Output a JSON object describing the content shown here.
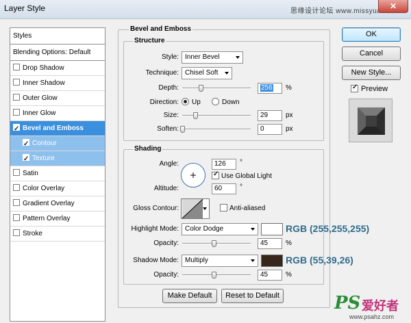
{
  "window": {
    "title": "Layer Style",
    "watermark_top": "思缘设计论坛 www.missyuan.com",
    "close_glyph": "✕"
  },
  "styles_panel": {
    "header": "Styles",
    "blending": "Blending Options: Default",
    "items": [
      {
        "label": "Drop Shadow",
        "checked": false
      },
      {
        "label": "Inner Shadow",
        "checked": false
      },
      {
        "label": "Outer Glow",
        "checked": false
      },
      {
        "label": "Inner Glow",
        "checked": false
      },
      {
        "label": "Bevel and Emboss",
        "checked": true
      },
      {
        "label": "Contour",
        "checked": true
      },
      {
        "label": "Texture",
        "checked": true
      },
      {
        "label": "Satin",
        "checked": false
      },
      {
        "label": "Color Overlay",
        "checked": false
      },
      {
        "label": "Gradient Overlay",
        "checked": false
      },
      {
        "label": "Pattern Overlay",
        "checked": false
      },
      {
        "label": "Stroke",
        "checked": false
      }
    ]
  },
  "bevel": {
    "title": "Bevel and Emboss",
    "structure": {
      "title": "Structure",
      "style_label": "Style:",
      "style_value": "Inner Bevel",
      "technique_label": "Technique:",
      "technique_value": "Chisel Soft",
      "depth_label": "Depth:",
      "depth_value": "256",
      "depth_unit": "%",
      "direction_label": "Direction:",
      "direction_up": "Up",
      "direction_down": "Down",
      "size_label": "Size:",
      "size_value": "29",
      "size_unit": "px",
      "soften_label": "Soften:",
      "soften_value": "0",
      "soften_unit": "px"
    },
    "shading": {
      "title": "Shading",
      "angle_label": "Angle:",
      "angle_value": "126",
      "angle_unit": "°",
      "global_light_label": "Use Global Light",
      "altitude_label": "Altitude:",
      "altitude_value": "60",
      "altitude_unit": "°",
      "gloss_label": "Gloss Contour:",
      "antialiased_label": "Anti-aliased",
      "highlight_label": "Highlight Mode:",
      "highlight_value": "Color Dodge",
      "highlight_opacity_label": "Opacity:",
      "highlight_opacity_value": "45",
      "highlight_opacity_unit": "%",
      "highlight_color": "#ffffff",
      "highlight_rgb": "RGB (255,255,255)",
      "shadow_label": "Shadow Mode:",
      "shadow_value": "Multiply",
      "shadow_opacity_label": "Opacity:",
      "shadow_opacity_value": "45",
      "shadow_opacity_unit": "%",
      "shadow_color": "#37271a",
      "shadow_rgb": "RGB (55,39,26)"
    },
    "make_default": "Make Default",
    "reset_default": "Reset to Default"
  },
  "actions": {
    "ok": "OK",
    "cancel": "Cancel",
    "new_style": "New Style...",
    "preview": "Preview"
  },
  "watermark_bottom": {
    "logo": "PS",
    "cn": "爱好者",
    "url": "www.psahz.com"
  }
}
